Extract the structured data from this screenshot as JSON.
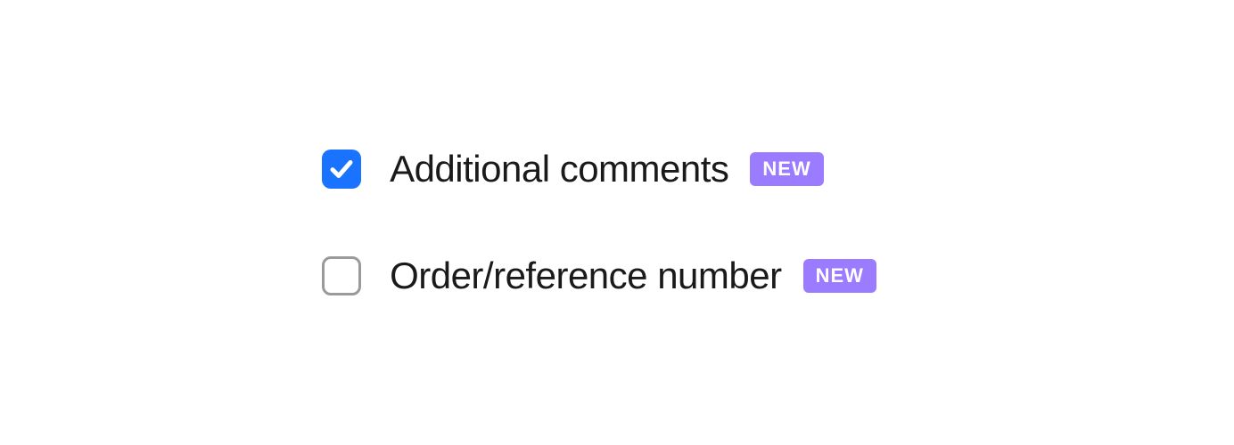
{
  "options": [
    {
      "label": "Additional comments",
      "checked": true,
      "badge": "NEW"
    },
    {
      "label": "Order/reference number",
      "checked": false,
      "badge": "NEW"
    }
  ]
}
